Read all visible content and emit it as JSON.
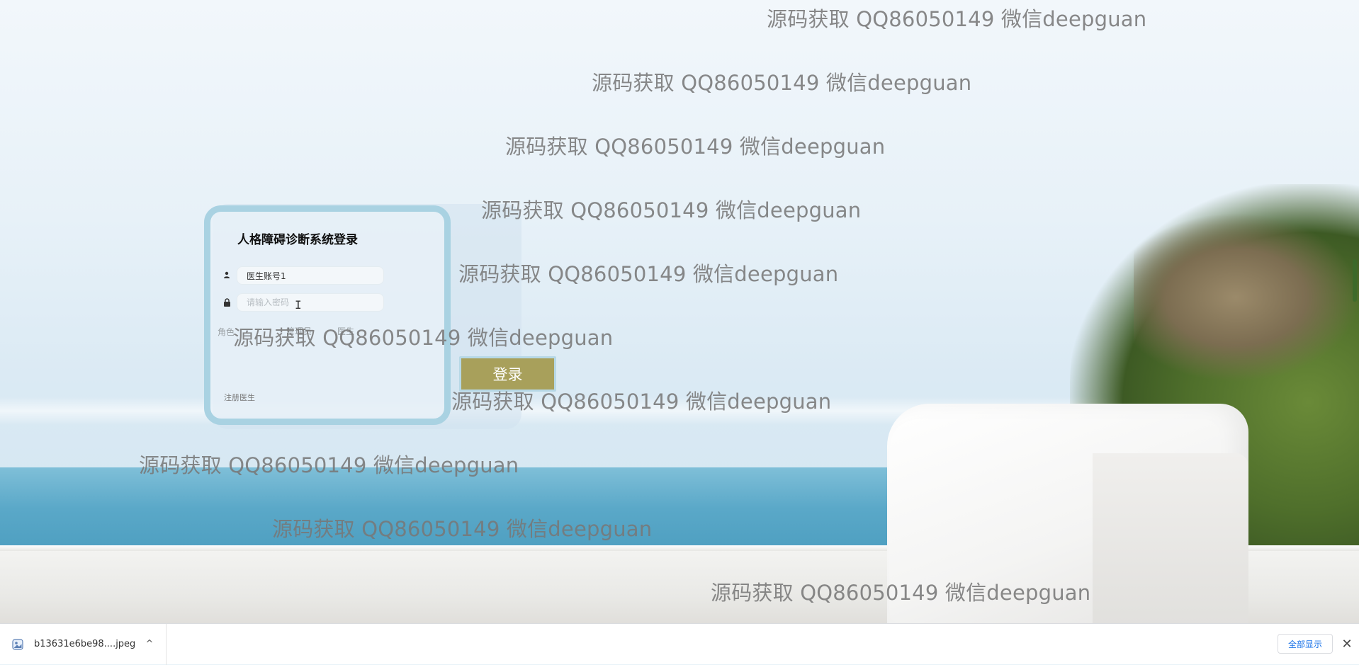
{
  "login": {
    "title": "人格障碍诊断系统登录",
    "username_value": "医生账号1",
    "password_placeholder": "请输入密码",
    "role_label": "角色",
    "role_options": [
      "管理员",
      "医生"
    ],
    "login_button": "登录",
    "register_link": "注册医生"
  },
  "watermark": {
    "text": "源码获取 QQ86050149 微信deepguan",
    "count": 10
  },
  "download_shelf": {
    "file_name": "b13631e6be98....jpeg",
    "show_all": "全部显示"
  },
  "colors": {
    "card_border": "#a9d2e2",
    "login_button": "#a8a05b",
    "watermark": "#787878"
  },
  "icons": {
    "user": "user-icon",
    "lock": "lock-icon",
    "file": "image-file-icon",
    "chevron": "chevron-up-icon",
    "close": "close-icon"
  }
}
